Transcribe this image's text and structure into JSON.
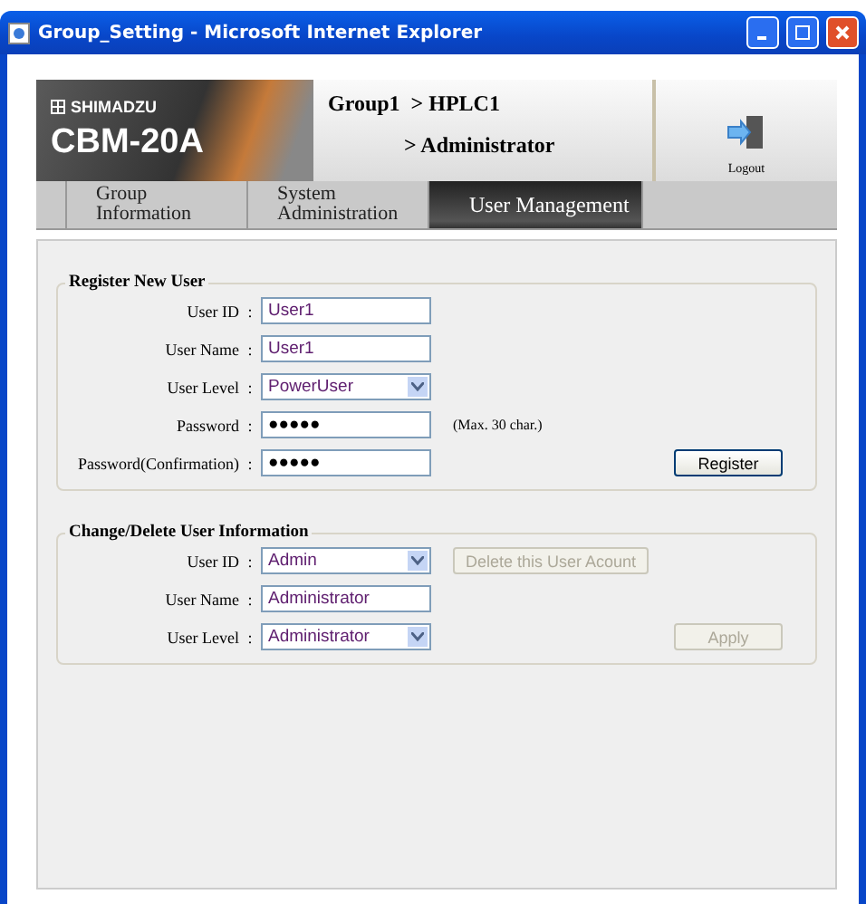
{
  "window": {
    "title": "Group_Setting - Microsoft Internet Explorer"
  },
  "header": {
    "brand": "SHIMADZU",
    "model": "CBM-20A",
    "path_line_1": "Group1  > HPLC1",
    "path_line_2": "> Administrator",
    "logout": "Logout"
  },
  "tabs": [
    {
      "label": "Group Information",
      "selected": false
    },
    {
      "label": "System Administration",
      "selected": false
    },
    {
      "label": "User Management",
      "selected": true
    }
  ],
  "sections": [
    {
      "title": "Register New User",
      "fields": [
        {
          "label": "User ID",
          "separator": ":",
          "kind": "text",
          "value": "User1"
        },
        {
          "label": "User Name",
          "separator": ":",
          "kind": "text",
          "value": "User1"
        },
        {
          "label": "User Level",
          "separator": ":",
          "kind": "select",
          "value": "PowerUser"
        },
        {
          "label": "Password",
          "separator": ":",
          "kind": "password",
          "value": "●●●●●",
          "note": "(Max. 30 char.)"
        },
        {
          "label": "Password(Confirmation)",
          "separator": ":",
          "kind": "password",
          "value": "●●●●●",
          "button": {
            "label": "Register",
            "disabled": false
          }
        }
      ]
    },
    {
      "title": "Change/Delete User Information",
      "fields": [
        {
          "label": "User ID",
          "separator": ":",
          "kind": "select",
          "value": "Admin",
          "button": {
            "label": "Delete this User Acount",
            "disabled": true
          }
        },
        {
          "label": "User Name",
          "separator": ":",
          "kind": "text",
          "value": "Administrator"
        },
        {
          "label": "User Level",
          "separator": ":",
          "kind": "select",
          "value": "Administrator",
          "button": {
            "label": "Apply",
            "disabled": true
          }
        }
      ]
    }
  ]
}
